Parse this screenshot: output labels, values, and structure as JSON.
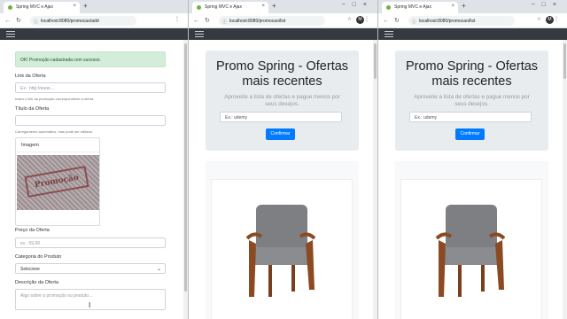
{
  "windows": [
    {
      "tab_title": "Spring MVC e Ajax",
      "url": "localhost:8080/promocao/add",
      "avatar": "M",
      "alert": "OK! Promoção cadastrada com sucesso.",
      "form": {
        "link_label": "Link da Oferta",
        "link_placeholder": "Ex.: http://www....",
        "link_help": "Insira o link da promoção correspondente a oferta.",
        "title_label": "Título da Oferta",
        "title_help": "Carregamento automático, mas pode ser editado.",
        "image_header": "Imagem",
        "image_stamp": "Promoção",
        "price_label": "Preço da Oferta",
        "price_placeholder": "ex.: 59,99",
        "category_label": "Categoria do Produto",
        "category_value": "Selecione",
        "desc_label": "Descrição da Oferta",
        "desc_placeholder": "Algo sobre a promoção ou produto..."
      }
    },
    {
      "tab_title": "Spring MVC e Ajax",
      "url": "localhost:8080/promocao/list",
      "avatar": "M",
      "heading": "Promo Spring - Ofertas mais recentes",
      "lead": "Aproveite a lista de ofertas e pague menos por seus desejos.",
      "search_value": "Ex.: udemy",
      "button": "Confirmar"
    },
    {
      "tab_title": "Spring MVC e Ajax",
      "url": "localhost:8080/promocao/list",
      "avatar": "M",
      "heading": "Promo Spring - Ofertas mais recentes",
      "lead": "Aproveite a lista de ofertas e pague menos por seus desejos.",
      "search_value": "Ex.: udemy",
      "button": "Confirmar"
    }
  ],
  "icons": {
    "back": "back-arrow-icon",
    "forward": "forward-arrow-icon",
    "reload": "reload-icon",
    "menu": "hamburger-icon",
    "product": "chair-image"
  }
}
